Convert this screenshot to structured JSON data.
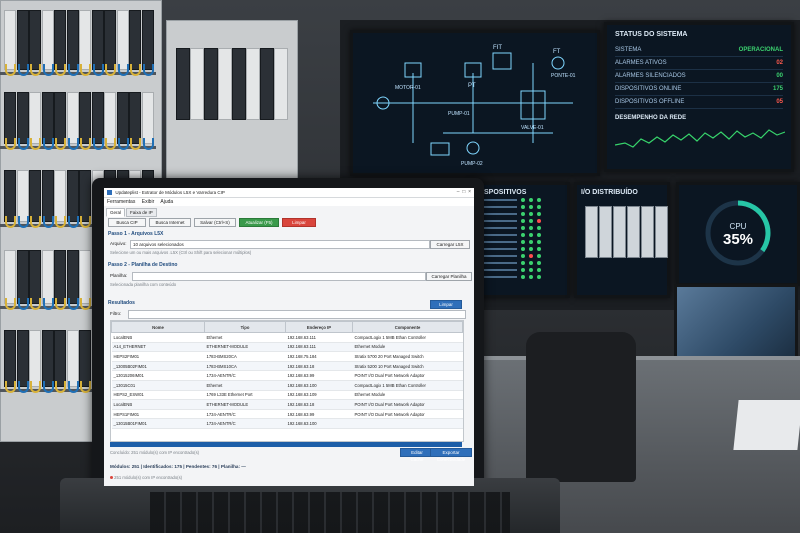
{
  "wall": {
    "system_status": {
      "title": "STATUS DO SISTEMA",
      "rows": [
        {
          "label": "SISTEMA",
          "value": "OPERACIONAL",
          "color": "#3bd16f"
        },
        {
          "label": "ALARMES ATIVOS",
          "value": "02",
          "color": "#ff5a4e"
        },
        {
          "label": "ALARMES SILENCIADOS",
          "value": "00",
          "color": "#3bd16f"
        },
        {
          "label": "DISPOSITIVOS ONLINE",
          "value": "175",
          "color": "#3bd16f"
        },
        {
          "label": "DISPOSITIVOS OFFLINE",
          "value": "05",
          "color": "#ff5a4e"
        }
      ],
      "network_title": "DESEMPENHO DA REDE"
    },
    "pid_labels": [
      "FIT",
      "FT",
      "PT",
      "MOTOR-01",
      "PUMP-01",
      "PUMP-02",
      "PONTE-01",
      "VALVE-01"
    ],
    "devices_title": "DISPOSITIVOS",
    "io_title": "I/O DISTRIBUÍDO",
    "cpu": {
      "label": "CPU",
      "value": "35%",
      "fraction": 0.35
    }
  },
  "app": {
    "title": "Updateplist - Extrator de Módulos L5X e Varredura CIP",
    "menu": [
      "Ferramentas",
      "Exibir",
      "Ajuda"
    ],
    "tabs": [
      "Geral",
      "Faixa de IP"
    ],
    "toolbar": {
      "busca_cip": "Busca CIP",
      "busca_internet": "Busca Internet",
      "salvar": "Salvar (Ctrl+S)",
      "atualizar": "Atualizar (F5)",
      "limpar": "Limpar"
    },
    "step1": {
      "title": "Passo 1 - Arquivos L5X",
      "label": "Arquivo:",
      "value": "10 arquivos selecionados",
      "button": "Carregar L5X",
      "hint": "Selecione um ou mais arquivos .L5X (Ctrl ou Shift para selecionar múltiplos)"
    },
    "step2": {
      "title": "Passo 2 - Planilha de Destino",
      "label": "Planilha:",
      "value": "",
      "button": "Carregar Planilha",
      "hint": "Selecionada planilha com conteúdo"
    },
    "results": {
      "title": "Resultados",
      "clear": "Limpar",
      "filter_label": "Filtro:",
      "columns": [
        "Nome",
        "Tipo",
        "Endereço IP",
        "Componente"
      ],
      "rows": [
        [
          "LocalENB",
          "Ethernet",
          "192.168.63.111",
          "CompactLogix 1 5MB Ethan Controller"
        ],
        [
          "A14_ETHERNET",
          "ETHERNET-MODULE",
          "192.168.63.111",
          "Ethernet Module"
        ],
        [
          "HEPS2FIM01",
          "1783-BMS20CA",
          "192.168.75.184",
          "Stratix 5700 20 Port Managed Switch"
        ],
        [
          "_13005B02FIM01",
          "1783-BMS10CA",
          "192.168.63.18",
          "Stratix 5200 10 Port Managed Switch"
        ],
        [
          "_13015206IM01",
          "1734-AENTR/C",
          "192.168.63.99",
          "POINT I/O Dual Port Network Adaptor"
        ],
        [
          "_13015C01",
          "Ethernet",
          "192.168.63.100",
          "CompactLogix 1 5MB Ethan Controller"
        ],
        [
          "HEPS2_ESW01",
          "1769 L33E Ethernet Port",
          "192.168.63.109",
          "Ethernet Module"
        ],
        [
          "LocalENB",
          "ETHERNET-MODULE",
          "192.168.63.18",
          "POINT I/O Dual Port Network Adaptor"
        ],
        [
          "HEPS1FIM01",
          "1734-AENTR/C",
          "192.168.63.99",
          "POINT I/O Dual Port Network Adaptor"
        ],
        [
          "_13015B01FIM01",
          "1734-AENTR/C",
          "192.168.63.100",
          ""
        ]
      ]
    },
    "actions": {
      "edit": "Editar Cache",
      "export": "Exportar Conectividade"
    },
    "scan_hint": "Concluído: 251 módulo(s) com IP encontrado(s)",
    "status": {
      "modulos": "Módulos: 251",
      "identificados": "Identificados: 175",
      "pendentes": "Pendentes: 76",
      "planilha": "Planilha: —"
    },
    "footer": "251 módulo(s) com IP encontrado(s)",
    "progress": 1.0
  }
}
